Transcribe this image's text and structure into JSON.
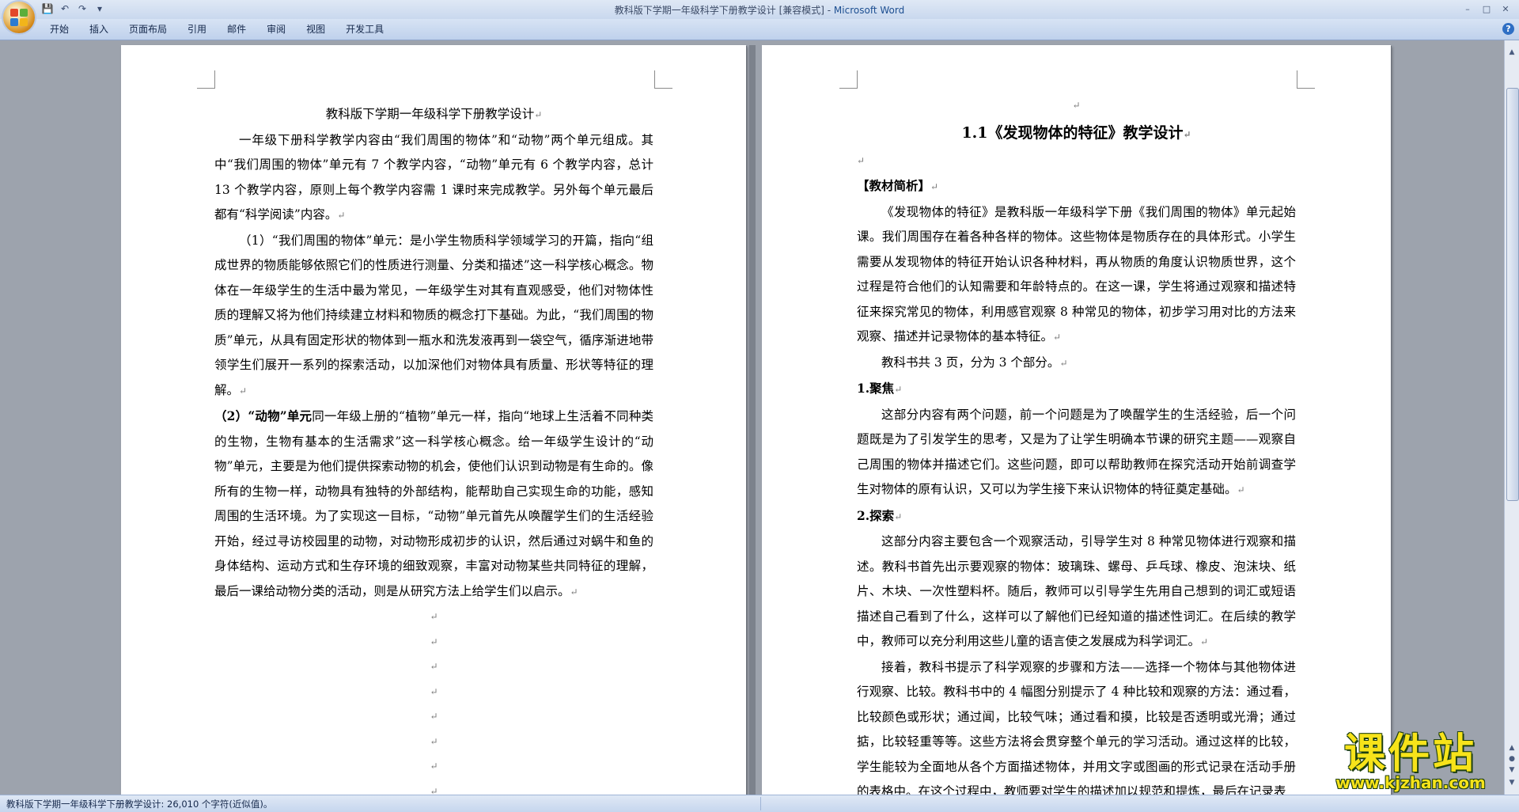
{
  "window": {
    "title": "教科版下学期一年级科学下册教学设计 [兼容模式] - ",
    "app_name": "Microsoft Word"
  },
  "qat": {
    "save_icon": "💾",
    "undo_icon": "↶",
    "redo_icon": "↷",
    "more_icon": "▾"
  },
  "winctl": {
    "minimize": "–",
    "maximize": "□",
    "close": "✕"
  },
  "ribbon": {
    "tabs": [
      "开始",
      "插入",
      "页面布局",
      "引用",
      "邮件",
      "审阅",
      "视图",
      "开发工具"
    ],
    "help": "?"
  },
  "left_page": {
    "title": "教科版下学期一年级科学下册教学设计",
    "p1": "一年级下册科学教学内容由“我们周围的物体”和“动物”两个单元组成。其中“我们周围的物体”单元有 7 个教学内容，“动物”单元有 6 个教学内容，总计 13 个教学内容，原则上每个教学内容需 1 课时来完成教学。另外每个单元最后都有“科学阅读”内容。",
    "p2": "（1）“我们周围的物体”单元：是小学生物质科学领域学习的开篇，指向“组成世界的物质能够依照它们的性质进行测量、分类和描述”这一科学核心概念。物体在一年级学生的生活中最为常见，一年级学生对其有直观感受，他们对物体性质的理解又将为他们持续建立材料和物质的概念打下基础。为此，“我们周围的物质”单元，从具有固定形状的物体到一瓶水和洗发液再到一袋空气，循序渐进地带领学生们展开一系列的探索活动，以加深他们对物体具有质量、形状等特征的理解。",
    "p3_bold": "（2）“动物”单元",
    "p3_rest": "同一年级上册的“植物”单元一样，指向“地球上生活着不同种类的生物，生物有基本的生活需求”这一科学核心概念。给一年级学生设计的“动物”单元，主要是为他们提供探索动物的机会，使他们认识到动物是有生命的。像所有的生物一样，动物具有独特的外部结构，能帮助自己实现生命的功能，感知周围的生活环境。为了实现这一目标，“动物”单元首先从唤醒学生们的生活经验开始，经过寻访校园里的动物，对动物形成初步的认识，然后通过对蜗牛和鱼的身体结构、运动方式和生存环境的细致观察，丰富对动物某些共同特征的理解，最后一课给动物分类的活动，则是从研究方法上给学生们以启示。",
    "para_mark": "↵"
  },
  "right_page": {
    "heading": "1.1《发现物体的特征》教学设计",
    "section1": "【教材简析】",
    "p1": "《发现物体的特征》是教科版一年级科学下册《我们周围的物体》单元起始课。我们周围存在着各种各样的物体。这些物体是物质存在的具体形式。小学生需要从发现物体的特征开始认识各种材料，再从物质的角度认识物质世界，这个过程是符合他们的认知需要和年龄特点的。在这一课，学生将通过观察和描述特征来探究常见的物体，利用感官观察 8 种常见的物体，初步学习用对比的方法来观察、描述并记录物体的基本特征。",
    "p2": "教科书共 3 页，分为 3 个部分。",
    "h_focus": "1.聚焦",
    "p3": "这部分内容有两个问题，前一个问题是为了唤醒学生的生活经验，后一个问题既是为了引发学生的思考，又是为了让学生明确本节课的研究主题——观察自己周围的物体并描述它们。这些问题，即可以帮助教师在探究活动开始前调查学生对物体的原有认识，又可以为学生接下来认识物体的特征奠定基础。",
    "h_explore": "2.探索",
    "p4": "这部分内容主要包含一个观察活动，引导学生对 8 种常见物体进行观察和描述。教科书首先出示要观察的物体：玻璃珠、螺母、乒乓球、橡皮、泡沫块、纸片、木块、一次性塑料杯。随后，教师可以引导学生先用自己想到的词汇或短语描述自己看到了什么，这样可以了解他们已经知道的描述性词汇。在后续的教学中，教师可以充分利用这些儿童的语言使之发展成为科学词汇。",
    "p5": "接着，教科书提示了科学观察的步骤和方法——选择一个物体与其他物体进行观察、比较。教科书中的 4 幅图分别提示了 4 种比较和观察的方法：通过看，比较颜色或形状；通过闻，比较气味；通过看和摸，比较是否透明或光滑；通过掂，比较轻重等等。这些方法将会贯穿整个单元的学习活动。通过这样的比较，学生能较为全面地从各个方面描述物体，并用文字或图画的形式记录在活动手册的表格中。在这个过程中，教师要对学生的描述加以规范和提炼，最后在记录表",
    "para_mark": "↵"
  },
  "statusbar": {
    "text": "教科版下学期一年级科学下册教学设计: 26,010 个字符(近似值)。"
  },
  "watermark": {
    "title": "课件站",
    "url": "www.kjzhan.com"
  },
  "colors": {
    "workspace": "#9da3ad",
    "ribbon": "#bfd1ec",
    "page": "#ffffff",
    "watermark": "#f7e31a"
  }
}
